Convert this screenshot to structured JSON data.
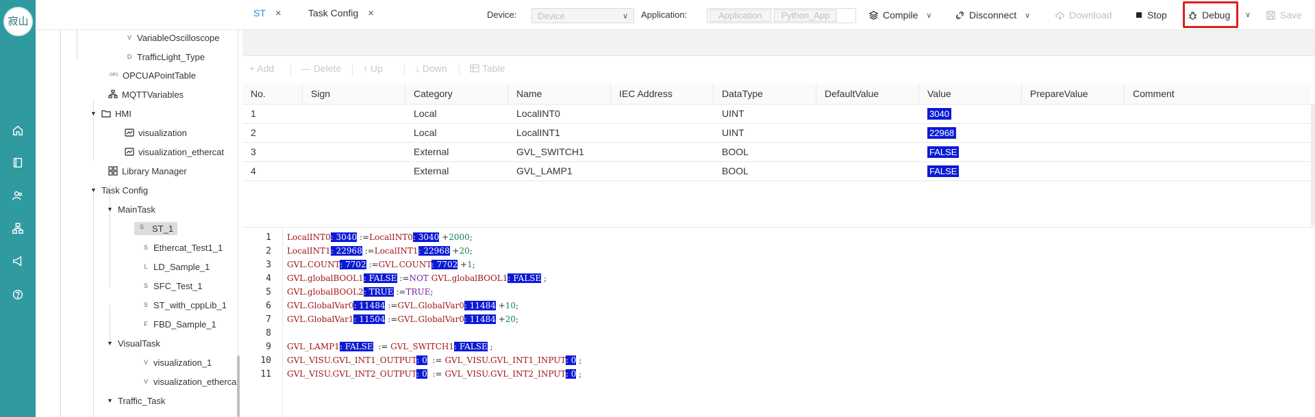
{
  "toolbar": {
    "device_label": "Device:",
    "device_value": "Device",
    "application_label": "Application:",
    "application_value": "Application",
    "application_sub": "Python_App",
    "compile": "Compile",
    "disconnect": "Disconnect",
    "download": "Download",
    "stop": "Stop",
    "debug": "Debug",
    "save": "Save"
  },
  "logo_text": "寂山",
  "sidebar": {
    "items": [
      {
        "badge": "V",
        "label": "VariableOscilloscope"
      },
      {
        "badge": "D",
        "label": "TrafficLight_Type"
      },
      {
        "badge": "OPC",
        "label": "OPCUAPointTable"
      },
      {
        "badge": "",
        "label": "MQTTVariables"
      },
      {
        "badge": "",
        "label": "HMI"
      },
      {
        "badge": "",
        "label": "visualization"
      },
      {
        "badge": "",
        "label": "visualization_ethercat"
      },
      {
        "badge": "",
        "label": "Library Manager"
      },
      {
        "badge": "",
        "label": "Task Config"
      },
      {
        "badge": "",
        "label": "MainTask"
      },
      {
        "badge": "S",
        "label": "ST_1"
      },
      {
        "badge": "S",
        "label": "Ethercat_Test1_1"
      },
      {
        "badge": "L",
        "label": "LD_Sample_1"
      },
      {
        "badge": "S",
        "label": "SFC_Test_1"
      },
      {
        "badge": "S",
        "label": "ST_with_cppLib_1"
      },
      {
        "badge": "F",
        "label": "FBD_Sample_1"
      },
      {
        "badge": "",
        "label": "VisualTask"
      },
      {
        "badge": "V",
        "label": "visualization_1"
      },
      {
        "badge": "V",
        "label": "visualization_etherca"
      },
      {
        "badge": "",
        "label": "Traffic_Task"
      }
    ]
  },
  "tabs": [
    {
      "label": "ST",
      "close": "×"
    },
    {
      "label": "Task Config",
      "close": "×"
    }
  ],
  "table_toolbar": {
    "add": "+ Add",
    "delete": "— Delete",
    "up": "↑ Up",
    "down": "↓ Down",
    "table": "Table"
  },
  "table": {
    "headers": [
      "No.",
      "Sign",
      "Category",
      "Name",
      "IEC Address",
      "DataType",
      "DefaultValue",
      "Value",
      "PrepareValue",
      "Comment"
    ],
    "rows": [
      {
        "no": "1",
        "category": "Local",
        "name": "LocalINT0",
        "datatype": "UINT",
        "value": "3040"
      },
      {
        "no": "2",
        "category": "Local",
        "name": "LocalINT1",
        "datatype": "UINT",
        "value": "22968"
      },
      {
        "no": "3",
        "category": "External",
        "name": "GVL_SWITCH1",
        "datatype": "BOOL",
        "value": "FALSE"
      },
      {
        "no": "4",
        "category": "External",
        "name": "GVL_LAMP1",
        "datatype": "BOOL",
        "value": "FALSE"
      }
    ]
  },
  "code": {
    "line_numbers": [
      "1",
      "2",
      "3",
      "4",
      "5",
      "6",
      "7",
      "8",
      "9",
      "10",
      "11"
    ],
    "lines": [
      [
        {
          "t": "LocalINT0",
          "c": "v"
        },
        {
          "t": ": 3040",
          "c": "hl"
        },
        {
          "t": " :=",
          "c": "op"
        },
        {
          "t": "LocalINT0",
          "c": "v"
        },
        {
          "t": ": 3040",
          "c": "hl"
        },
        {
          "t": " +",
          "c": "op"
        },
        {
          "t": "2000",
          "c": "num"
        },
        {
          "t": ";",
          "c": "op"
        }
      ],
      [
        {
          "t": "LocalINT1",
          "c": "v"
        },
        {
          "t": ": 22968",
          "c": "hl"
        },
        {
          "t": " :=",
          "c": "op"
        },
        {
          "t": "LocalINT1",
          "c": "v"
        },
        {
          "t": ": 22968",
          "c": "hl"
        },
        {
          "t": " +",
          "c": "op"
        },
        {
          "t": "20",
          "c": "num"
        },
        {
          "t": ";",
          "c": "op"
        }
      ],
      [
        {
          "t": "GVL.COUNT",
          "c": "v"
        },
        {
          "t": ": 7702",
          "c": "hl"
        },
        {
          "t": " :=",
          "c": "op"
        },
        {
          "t": "GVL.COUNT",
          "c": "v"
        },
        {
          "t": ": 7702",
          "c": "hl"
        },
        {
          "t": " +",
          "c": "op"
        },
        {
          "t": "1",
          "c": "num"
        },
        {
          "t": ";",
          "c": "op"
        }
      ],
      [
        {
          "t": "GVL.globalBOOL1",
          "c": "v"
        },
        {
          "t": ": FALSE",
          "c": "hl"
        },
        {
          "t": " :=",
          "c": "op"
        },
        {
          "t": "NOT ",
          "c": "kw"
        },
        {
          "t": "GVL.globalBOOL1",
          "c": "v"
        },
        {
          "t": ": FALSE",
          "c": "hl"
        },
        {
          "t": " ;",
          "c": "op"
        }
      ],
      [
        {
          "t": "GVL.globalBOOL2",
          "c": "v"
        },
        {
          "t": ": TRUE",
          "c": "hl"
        },
        {
          "t": " :=",
          "c": "op"
        },
        {
          "t": "TRUE",
          "c": "kw"
        },
        {
          "t": ";",
          "c": "op"
        }
      ],
      [
        {
          "t": "GVL.GlobalVar0",
          "c": "v"
        },
        {
          "t": ": 11484",
          "c": "hl"
        },
        {
          "t": " :=",
          "c": "op"
        },
        {
          "t": "GVL.GlobalVar0",
          "c": "v"
        },
        {
          "t": ": 11484",
          "c": "hl"
        },
        {
          "t": " +",
          "c": "op"
        },
        {
          "t": "10",
          "c": "num"
        },
        {
          "t": ";",
          "c": "op"
        }
      ],
      [
        {
          "t": "GVL.GlobalVar1",
          "c": "v"
        },
        {
          "t": ": 11504",
          "c": "hl"
        },
        {
          "t": " :=",
          "c": "op"
        },
        {
          "t": "GVL.GlobalVar0",
          "c": "v"
        },
        {
          "t": ": 11484",
          "c": "hl"
        },
        {
          "t": " +",
          "c": "op"
        },
        {
          "t": "20",
          "c": "num"
        },
        {
          "t": ";",
          "c": "op"
        }
      ],
      [],
      [
        {
          "t": "GVL_LAMP1",
          "c": "v"
        },
        {
          "t": ": FALSE",
          "c": "hl"
        },
        {
          "t": "  := ",
          "c": "op"
        },
        {
          "t": "GVL_SWITCH1",
          "c": "v"
        },
        {
          "t": ": FALSE",
          "c": "hl"
        },
        {
          "t": " ;",
          "c": "op"
        }
      ],
      [
        {
          "t": "GVL_VISU.GVL_INT1_OUTPUT",
          "c": "v"
        },
        {
          "t": ": 0",
          "c": "hl"
        },
        {
          "t": "  := ",
          "c": "op"
        },
        {
          "t": "GVL_VISU.GVL_INT1_INPUT",
          "c": "v"
        },
        {
          "t": ": 0",
          "c": "hl"
        },
        {
          "t": " ;",
          "c": "op"
        }
      ],
      [
        {
          "t": "GVL_VISU.GVL_INT2_OUTPUT",
          "c": "v"
        },
        {
          "t": ": 0",
          "c": "hl"
        },
        {
          "t": "  := ",
          "c": "op"
        },
        {
          "t": "GVL_VISU.GVL_INT2_INPUT",
          "c": "v"
        },
        {
          "t": ": 0",
          "c": "hl"
        },
        {
          "t": " ;",
          "c": "op"
        }
      ]
    ]
  },
  "icons": {
    "rail": [
      "home-icon",
      "book-icon",
      "users-icon",
      "network-icon",
      "megaphone-icon",
      "help-icon"
    ]
  },
  "colors": {
    "rail": "#2f9aa0",
    "highlight": "#0b1ad6",
    "debug_outline": "#e01b1b",
    "active_tab": "#2f8fd6"
  }
}
